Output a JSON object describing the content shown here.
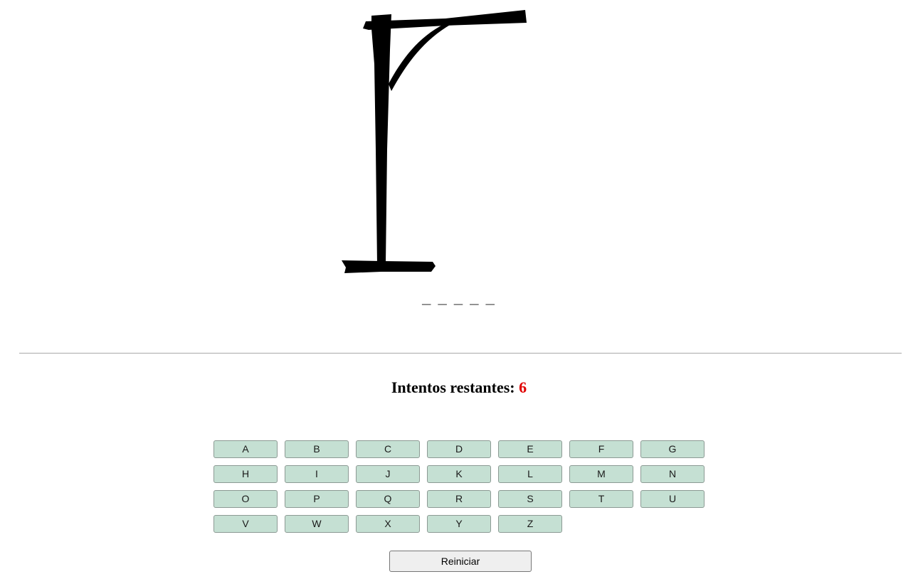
{
  "gallows": {
    "icon": "gallows-image"
  },
  "word": {
    "display": "_ _ _ _ _"
  },
  "attempts": {
    "label": "Intentos restantes:",
    "count": "6",
    "count_color": "#e00000"
  },
  "keyboard": {
    "letters": [
      "A",
      "B",
      "C",
      "D",
      "E",
      "F",
      "G",
      "H",
      "I",
      "J",
      "K",
      "L",
      "M",
      "N",
      "O",
      "P",
      "Q",
      "R",
      "S",
      "T",
      "U",
      "V",
      "W",
      "X",
      "Y",
      "Z"
    ],
    "key_color": "#c5e0d3"
  },
  "reset": {
    "label": "Reiniciar"
  }
}
